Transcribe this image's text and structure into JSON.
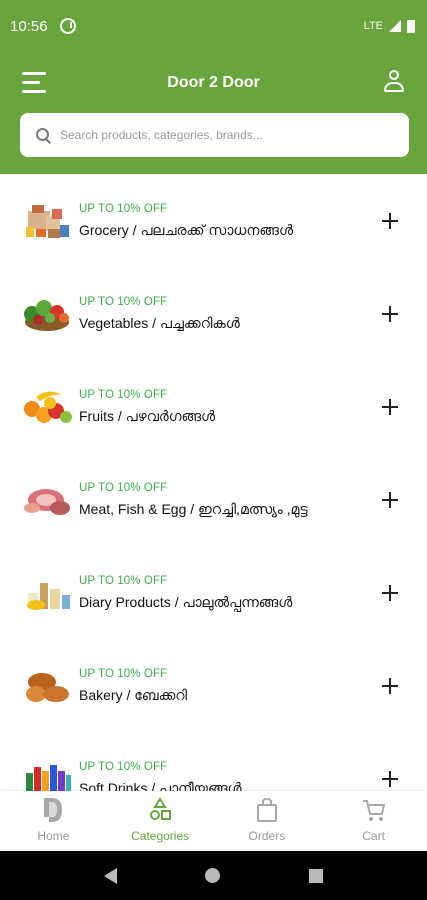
{
  "status_bar": {
    "time": "10:56",
    "network": "LTE"
  },
  "app_bar": {
    "title": "Door 2 Door"
  },
  "search": {
    "placeholder": "Search products, categories, brands..."
  },
  "categories": [
    {
      "offer": "UP TO 10% OFF",
      "name": "Grocery / പലചരക്ക് സാധനങ്ങൾ",
      "icon": "grocery-icon"
    },
    {
      "offer": "UP TO 10% OFF",
      "name": "Vegetables / പച്ചക്കറികൾ",
      "icon": "vegetables-icon"
    },
    {
      "offer": "UP TO 10% OFF",
      "name": "Fruits / പഴവർഗങ്ങൾ",
      "icon": "fruits-icon"
    },
    {
      "offer": "UP TO 10% OFF",
      "name": "Meat, Fish & Egg / ഇറച്ചി,മത്സ്യം ,മുട്ട",
      "icon": "meat-icon"
    },
    {
      "offer": "UP TO 10% OFF",
      "name": "Diary Products / പാലുൽപ്പന്നങ്ങൾ",
      "icon": "dairy-icon"
    },
    {
      "offer": "UP TO 10% OFF",
      "name": "Bakery / ബേക്കറി",
      "icon": "bakery-icon"
    },
    {
      "offer": "UP TO 10% OFF",
      "name": "Soft Drinks / പാനീയങ്ങൾ",
      "icon": "drinks-icon"
    }
  ],
  "bottom_nav": {
    "items": [
      {
        "label": "Home",
        "icon": "home-icon",
        "active": false
      },
      {
        "label": "Categories",
        "icon": "categories-icon",
        "active": true
      },
      {
        "label": "Orders",
        "icon": "bag-icon",
        "active": false
      },
      {
        "label": "Cart",
        "icon": "cart-icon",
        "active": false
      }
    ]
  },
  "colors": {
    "brand": "#68a63d",
    "offer": "#3fae4a"
  }
}
